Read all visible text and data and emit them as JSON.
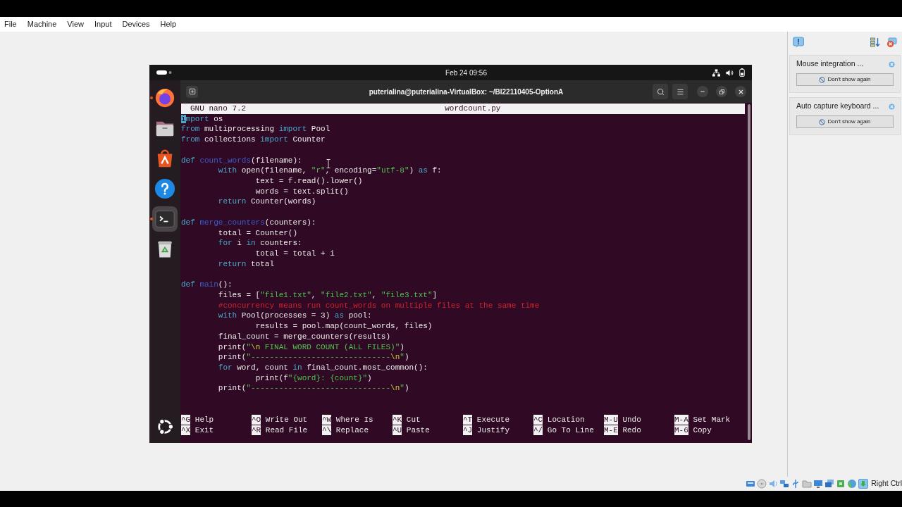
{
  "host_menu": [
    "File",
    "Machine",
    "View",
    "Input",
    "Devices",
    "Help"
  ],
  "vm": {
    "top_bar": {
      "clock": "Feb 24 09:56"
    },
    "dock": [
      {
        "kind": "browser",
        "running": true,
        "selected": false
      },
      {
        "kind": "files",
        "running": false,
        "selected": false
      },
      {
        "kind": "store",
        "running": false,
        "selected": false
      },
      {
        "kind": "help",
        "running": false,
        "selected": false
      },
      {
        "kind": "terminal",
        "running": true,
        "selected": true
      },
      {
        "kind": "trash",
        "running": false,
        "selected": false
      }
    ],
    "terminal": {
      "title": "puterialina@puterialina-VirtualBox: ~/BI22110405-OptionA",
      "nano": {
        "version": "GNU nano 7.2",
        "filename": "wordcount.py",
        "code_blocks": [
          [
            {
              "tokens": [
                {
                  "kind": "keyword",
                  "text": "import",
                  "cursor": true
                },
                {
                  "kind": "plain",
                  "text": " os"
                }
              ]
            },
            {
              "tokens": [
                {
                  "kind": "keyword",
                  "text": "from"
                },
                {
                  "kind": "plain",
                  "text": " multiprocessing "
                },
                {
                  "kind": "keyword",
                  "text": "import"
                },
                {
                  "kind": "plain",
                  "text": " Pool"
                }
              ]
            },
            {
              "tokens": [
                {
                  "kind": "keyword",
                  "text": "from"
                },
                {
                  "kind": "plain",
                  "text": " collections "
                },
                {
                  "kind": "keyword",
                  "text": "import"
                },
                {
                  "kind": "plain",
                  "text": " Counter"
                }
              ]
            }
          ],
          [
            {
              "tokens": [
                {
                  "kind": "keyword",
                  "text": "def "
                },
                {
                  "kind": "function",
                  "text": "count_words"
                },
                {
                  "kind": "plain",
                  "text": "(filename):"
                }
              ]
            },
            {
              "tokens": [
                {
                  "kind": "keyword",
                  "text": "\twith"
                },
                {
                  "kind": "plain",
                  "text": " open(filename, "
                },
                {
                  "kind": "string",
                  "text": "\"r\""
                },
                {
                  "kind": "plain",
                  "text": ", encoding="
                },
                {
                  "kind": "string",
                  "text": "\"utf-8\""
                },
                {
                  "kind": "plain",
                  "text": ") "
                },
                {
                  "kind": "keyword",
                  "text": "as"
                },
                {
                  "kind": "plain",
                  "text": " f:"
                }
              ]
            },
            {
              "tokens": [
                {
                  "kind": "plain",
                  "text": "\t\ttext = f.read().lower()"
                }
              ]
            },
            {
              "tokens": [
                {
                  "kind": "plain",
                  "text": "\t\twords = text.split()"
                }
              ]
            },
            {
              "tokens": [
                {
                  "kind": "keyword",
                  "text": "\treturn"
                },
                {
                  "kind": "plain",
                  "text": " Counter(words)"
                }
              ]
            }
          ],
          [
            {
              "tokens": [
                {
                  "kind": "keyword",
                  "text": "def "
                },
                {
                  "kind": "function",
                  "text": "merge_counters"
                },
                {
                  "kind": "plain",
                  "text": "(counters):"
                }
              ]
            },
            {
              "tokens": [
                {
                  "kind": "plain",
                  "text": "\ttotal = Counter()"
                }
              ]
            },
            {
              "tokens": [
                {
                  "kind": "keyword",
                  "text": "\tfor"
                },
                {
                  "kind": "plain",
                  "text": " i "
                },
                {
                  "kind": "keyword",
                  "text": "in"
                },
                {
                  "kind": "plain",
                  "text": " counters:"
                }
              ]
            },
            {
              "tokens": [
                {
                  "kind": "plain",
                  "text": "\t\ttotal = total + i"
                }
              ]
            },
            {
              "tokens": [
                {
                  "kind": "keyword",
                  "text": "\treturn"
                },
                {
                  "kind": "plain",
                  "text": " total"
                }
              ]
            }
          ],
          [
            {
              "tokens": [
                {
                  "kind": "keyword",
                  "text": "def "
                },
                {
                  "kind": "function",
                  "text": "main"
                },
                {
                  "kind": "plain",
                  "text": "():"
                }
              ]
            },
            {
              "tokens": [
                {
                  "kind": "plain",
                  "text": "\tfiles = ["
                },
                {
                  "kind": "string",
                  "text": "\"file1.txt\""
                },
                {
                  "kind": "plain",
                  "text": ", "
                },
                {
                  "kind": "string",
                  "text": "\"file2.txt\""
                },
                {
                  "kind": "plain",
                  "text": ", "
                },
                {
                  "kind": "string",
                  "text": "\"file3.txt\""
                },
                {
                  "kind": "plain",
                  "text": "]"
                }
              ]
            },
            {
              "tokens": [
                {
                  "kind": "comment",
                  "text": "\t#concurrency means run count_words on multiple files at the same time"
                }
              ]
            },
            {
              "tokens": [
                {
                  "kind": "keyword",
                  "text": "\twith"
                },
                {
                  "kind": "plain",
                  "text": " Pool(processes = 3) "
                },
                {
                  "kind": "keyword",
                  "text": "as"
                },
                {
                  "kind": "plain",
                  "text": " pool:"
                }
              ]
            },
            {
              "tokens": [
                {
                  "kind": "plain",
                  "text": "\t\tresults = pool.map(count_words, files)"
                }
              ]
            },
            {
              "tokens": [
                {
                  "kind": "plain",
                  "text": "\tfinal_count = merge_counters(results)"
                }
              ]
            },
            {
              "tokens": [
                {
                  "kind": "plain",
                  "text": "\tprint("
                },
                {
                  "kind": "string",
                  "text": "\""
                },
                {
                  "kind": "escape",
                  "text": "\\n"
                },
                {
                  "kind": "string",
                  "text": " FINAL WORD COUNT (ALL FILES)\""
                },
                {
                  "kind": "plain",
                  "text": ")"
                }
              ]
            },
            {
              "tokens": [
                {
                  "kind": "plain",
                  "text": "\tprint("
                },
                {
                  "kind": "string",
                  "text": "\"------------------------------"
                },
                {
                  "kind": "escape",
                  "text": "\\n"
                },
                {
                  "kind": "string",
                  "text": "\""
                },
                {
                  "kind": "plain",
                  "text": ")"
                }
              ]
            },
            {
              "tokens": [
                {
                  "kind": "keyword",
                  "text": "\tfor"
                },
                {
                  "kind": "plain",
                  "text": " word, count "
                },
                {
                  "kind": "keyword",
                  "text": "in"
                },
                {
                  "kind": "plain",
                  "text": " final_count.most_common():"
                }
              ]
            },
            {
              "tokens": [
                {
                  "kind": "plain",
                  "text": "\t\tprint(f"
                },
                {
                  "kind": "string",
                  "text": "\"{word}: {count}\""
                },
                {
                  "kind": "plain",
                  "text": ")"
                }
              ]
            },
            {
              "tokens": [
                {
                  "kind": "plain",
                  "text": "\tprint("
                },
                {
                  "kind": "string",
                  "text": "\"------------------------------"
                },
                {
                  "kind": "escape",
                  "text": "\\n"
                },
                {
                  "kind": "string",
                  "text": "\""
                },
                {
                  "kind": "plain",
                  "text": ")"
                }
              ]
            }
          ]
        ],
        "shortcut_rows": [
          [
            {
              "key": "^G",
              "label": "Help"
            },
            {
              "key": "^O",
              "label": "Write Out"
            },
            {
              "key": "^W",
              "label": "Where Is"
            },
            {
              "key": "^K",
              "label": "Cut"
            },
            {
              "key": "^T",
              "label": "Execute"
            },
            {
              "key": "^C",
              "label": "Location"
            },
            {
              "key": "M-U",
              "label": "Undo"
            },
            {
              "key": "M-A",
              "label": "Set Mark"
            }
          ],
          [
            {
              "key": "^X",
              "label": "Exit"
            },
            {
              "key": "^R",
              "label": "Read File"
            },
            {
              "key": "^\\",
              "label": "Replace"
            },
            {
              "key": "^U",
              "label": "Paste"
            },
            {
              "key": "^J",
              "label": "Justify"
            },
            {
              "key": "^/",
              "label": "Go To Line"
            },
            {
              "key": "M-E",
              "label": "Redo"
            },
            {
              "key": "M-6",
              "label": "Copy"
            }
          ]
        ]
      }
    }
  },
  "notifications": [
    {
      "title": "Mouse integration ...",
      "action": "Don't show again"
    },
    {
      "title": "Auto capture keyboard ...",
      "action": "Don't show again"
    }
  ],
  "status_bar": {
    "host_key": "Right Ctrl"
  }
}
